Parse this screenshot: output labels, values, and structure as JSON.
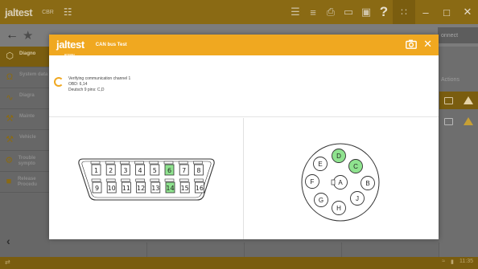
{
  "app": {
    "logo_main": "jaltest",
    "logo_sub": "CBR",
    "logo_sub2": "ᐅ",
    "nav_right_label": "onnect"
  },
  "sidebar": {
    "items": [
      {
        "label": "Diagno",
        "icon": "connector-icon",
        "active": true
      },
      {
        "label": "System data",
        "icon": "omega-icon",
        "active": false
      },
      {
        "label": "Diagra",
        "icon": "wave-icon",
        "active": false
      },
      {
        "label": "Mainte",
        "icon": "wrench-icon",
        "active": false
      },
      {
        "label": "Vehicle",
        "icon": "tools-icon",
        "active": false
      },
      {
        "label": "Trouble sympto",
        "icon": "tractor-icon",
        "active": false
      },
      {
        "label": "Release Procedu",
        "icon": "book-icon",
        "active": false
      }
    ]
  },
  "right_panel": {
    "actions_label": "Actions"
  },
  "statusbar": {
    "time": "11:35"
  },
  "modal": {
    "logo": "jaltest",
    "logo_sub": "BY COJALI",
    "title": "CAN bus Test",
    "status_lines": [
      "Verifying communication channel 1",
      "OBD: 6,14",
      "Deutsch 9 pins: C,D"
    ],
    "obd_pins_top": [
      "1",
      "2",
      "3",
      "4",
      "5",
      "6",
      "7",
      "8"
    ],
    "obd_pins_bottom": [
      "9",
      "10",
      "11",
      "12",
      "13",
      "14",
      "15",
      "16"
    ],
    "obd_highlighted": [
      "6",
      "14"
    ],
    "deutsch_pins": [
      "A",
      "B",
      "C",
      "D",
      "E",
      "F",
      "G",
      "H",
      "J"
    ],
    "deutsch_highlighted": [
      "C",
      "D"
    ],
    "highlight_color": "#8fe38f",
    "accent_color": "#f0a820"
  }
}
